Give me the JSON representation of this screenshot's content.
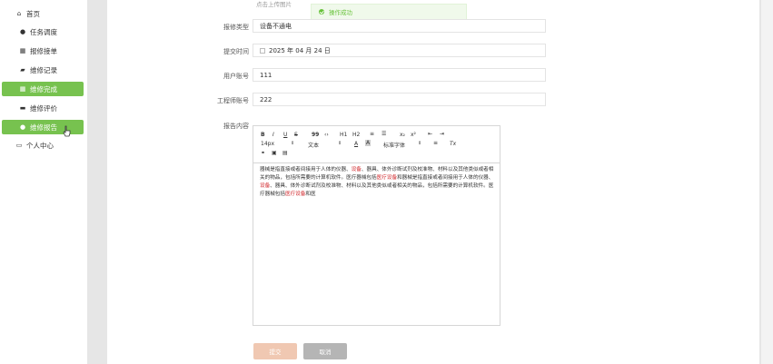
{
  "sidebar": {
    "home": "首页",
    "items": [
      {
        "label": "任务调度"
      },
      {
        "label": "报修接单"
      },
      {
        "label": "维修记录"
      },
      {
        "label": "维修完成"
      },
      {
        "label": "维修评价"
      },
      {
        "label": "维修报告"
      }
    ],
    "personal": "个人中心"
  },
  "form": {
    "upload_hint": "点击上传图片",
    "toast": "操作成功",
    "repair_type_label": "报修类型",
    "repair_type_value": "设备不通电",
    "submit_time_label": "提交时间",
    "submit_time_value": "2025 年 04 月 24 日",
    "user_account_label": "用户账号",
    "user_account_value": "111",
    "engineer_account_label": "工程师账号",
    "engineer_account_value": "222",
    "report_label": "报告内容"
  },
  "editor": {
    "toolbar": {
      "bold": "B",
      "italic": "I",
      "underline": "U",
      "strike": "S",
      "quote": "99",
      "code": "‹›",
      "h1": "H1",
      "h2": "H2",
      "ol": "≡",
      "ul": "☰",
      "sub": "x₂",
      "sup": "x²",
      "indent_l": "⇤",
      "indent_r": "⇥",
      "font_size": "14px",
      "text_style": "文本",
      "font_family": "标准字体",
      "align": "≡",
      "clear": "Tx"
    },
    "segments": [
      {
        "text": "器械是指直接或者间接用于人体的仪器、",
        "hl": false
      },
      {
        "text": "设备",
        "hl": true
      },
      {
        "text": "、器具、体外诊断试剂及校准物、材料以及其他类似或者相关的物品，包括所需要的计算机软件。医疗器械包括",
        "hl": false
      },
      {
        "text": "医疗设备",
        "hl": true
      },
      {
        "text": "和器械是指直接或者间接用于人体的仪器、",
        "hl": false
      },
      {
        "text": "设备",
        "hl": true
      },
      {
        "text": "、器具、体外诊断试剂及校准物、材料以及其他类似或者相关的物品，包括所需要的计算机软件。医疗器械包括",
        "hl": false
      },
      {
        "text": "医疗设备",
        "hl": true
      },
      {
        "text": "和医",
        "hl": false
      }
    ]
  },
  "buttons": {
    "submit": "提交",
    "cancel": "取消"
  },
  "colors": {
    "accent": "#77c24f",
    "highlight": "#d0262a",
    "toast_text": "#67c23a"
  }
}
